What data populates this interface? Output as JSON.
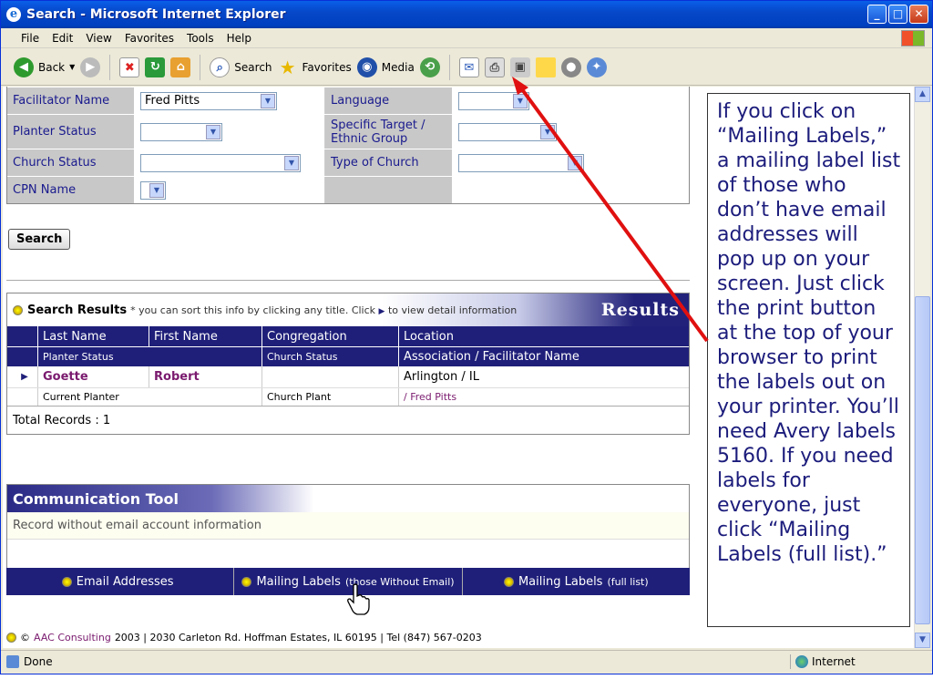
{
  "window": {
    "title": "Search - Microsoft Internet Explorer",
    "minimize": "_",
    "maximize": "□",
    "close": "✕"
  },
  "menu": [
    "File",
    "Edit",
    "View",
    "Favorites",
    "Tools",
    "Help"
  ],
  "toolbar": {
    "back": "Back",
    "search": "Search",
    "favorites": "Favorites",
    "media": "Media"
  },
  "form": {
    "rows": [
      {
        "label1": "Facilitator Name",
        "value1": "Fred Pitts",
        "label2": "Language",
        "value2": ""
      },
      {
        "label1": "Planter Status",
        "value1": "",
        "label2": "Specific Target / Ethnic Group",
        "value2": ""
      },
      {
        "label1": "Church Status",
        "value1": "",
        "label2": "Type of Church",
        "value2": ""
      },
      {
        "label1": "CPN Name",
        "value1": "",
        "label2": "",
        "value2": ""
      }
    ],
    "search_button": "Search"
  },
  "results": {
    "heading": "Search Results",
    "hint_prefix": "* you can sort this info by clicking any title. Click",
    "hint_suffix": "to view detail information",
    "badge": "Results",
    "columns_row1": [
      "Last Name",
      "First Name",
      "Congregation",
      "Location"
    ],
    "columns_row2": [
      "Planter Status",
      "Church Status",
      "Association / Facilitator Name"
    ],
    "records": [
      {
        "last_name": "Goette",
        "first_name": "Robert",
        "congregation": "",
        "location": "Arlington / IL",
        "planter_status": "Current Planter",
        "church_status": "Church Plant",
        "association": "/ Fred Pitts"
      }
    ],
    "total": "Total Records : 1"
  },
  "communication": {
    "title": "Communication Tool",
    "message": "Record without email account information",
    "buttons": [
      {
        "label": "Email Addresses",
        "note": ""
      },
      {
        "label": "Mailing Labels",
        "note": "(those Without Email)"
      },
      {
        "label": "Mailing Labels",
        "note": "(full list)"
      }
    ]
  },
  "footer": {
    "copyright": "©",
    "company": "AAC Consulting",
    "rest": "2003 | 2030 Carleton Rd. Hoffman Estates, IL 60195 | Tel  (847) 567-0203"
  },
  "status": {
    "text": "Done",
    "zone": "Internet"
  },
  "callout": {
    "text": "If you click on “Mailing Labels,” a mailing label list of those who don’t have email addresses will pop up on your screen.  Just click the print button at the top of your browser to print the labels out on your printer.  You’ll need Avery labels 5160.  If you need labels for everyone, just click “Mailing Labels (full list).”"
  },
  "colors": {
    "accent": "#1f1f7a",
    "link": "#7a1a6e",
    "arrow": "#e01010"
  }
}
